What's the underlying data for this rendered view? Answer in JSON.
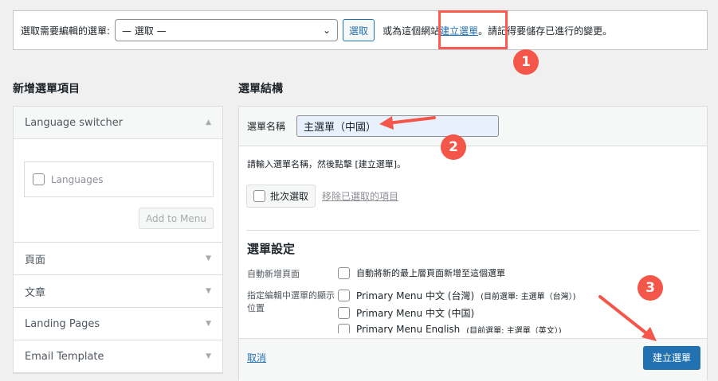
{
  "top": {
    "label": "選取需要編輯的選單:",
    "select_value": "— 選取 —",
    "select_button": "選取",
    "or_text": "或為這個網站",
    "create_link": "建立選單",
    "after_text": "。請記得要儲存已進行的變更。"
  },
  "left": {
    "heading": "新增選單項目",
    "language_switcher": "Language switcher",
    "languages": "Languages",
    "add_to_menu": "Add to Menu",
    "sections": [
      "頁面",
      "文章",
      "Landing Pages",
      "Email Template"
    ]
  },
  "right": {
    "heading": "選單結構",
    "name_label": "選單名稱",
    "name_value": "主選單（中國）",
    "instructions": "請輸入選單名稱，然後點擊 [建立選單]。",
    "bulk_select": "批次選取",
    "remove_selected": "移除已選取的項目",
    "settings_heading": "選單設定",
    "auto_add_label": "自動新增頁面",
    "auto_add_option": "自動將新的最上層頁面新增至這個選單",
    "location_label": "指定編輯中選單的顯示位置",
    "locations": [
      {
        "name": "Primary Menu 中文 (台灣)",
        "note": "(目前選單: 主選單（台灣）)"
      },
      {
        "name": "Primary Menu 中文 (中国)",
        "note": ""
      },
      {
        "name": "Primary Menu English",
        "note": "(目前選單: 主選單（英文）)"
      }
    ],
    "cancel": "取消",
    "create_button": "建立選單"
  },
  "annotations": [
    "1",
    "2",
    "3"
  ],
  "colors": {
    "accent": "#2271b1",
    "annotation": "#f4564a"
  }
}
